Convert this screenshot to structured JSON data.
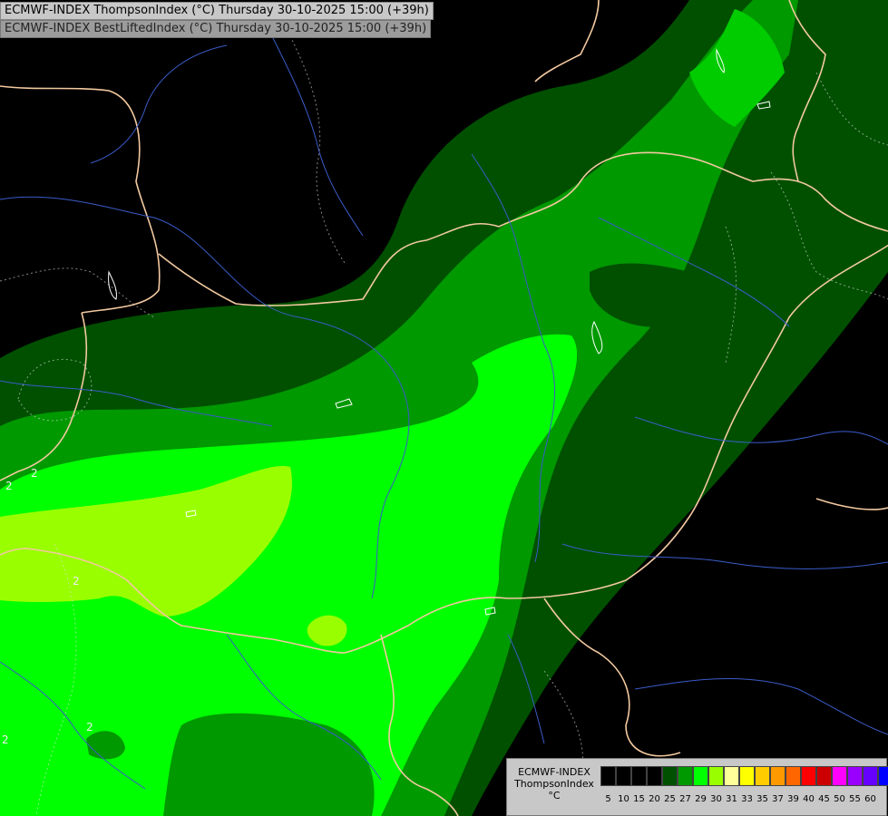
{
  "header": {
    "title_line1": "ECMWF-INDEX ThompsonIndex (°C) Thursday 30-10-2025 15:00 (+39h)",
    "title_line2": "ECMWF-INDEX BestLiftedIndex (°C) Thursday 30-10-2025 15:00 (+39h)"
  },
  "legend": {
    "line1": "ECMWF-INDEX",
    "line2": "ThompsonIndex",
    "line3": "°C",
    "items": [
      {
        "label": "5",
        "color": "#000000"
      },
      {
        "label": "10",
        "color": "#000000"
      },
      {
        "label": "15",
        "color": "#000000"
      },
      {
        "label": "20",
        "color": "#000000"
      },
      {
        "label": "25",
        "color": "#005000"
      },
      {
        "label": "27",
        "color": "#009900"
      },
      {
        "label": "29",
        "color": "#00ff00"
      },
      {
        "label": "30",
        "color": "#99ff00"
      },
      {
        "label": "31",
        "color": "#ffff99"
      },
      {
        "label": "33",
        "color": "#ffff00"
      },
      {
        "label": "35",
        "color": "#ffcc00"
      },
      {
        "label": "37",
        "color": "#ff9900"
      },
      {
        "label": "39",
        "color": "#ff6600"
      },
      {
        "label": "40",
        "color": "#ff0000"
      },
      {
        "label": "45",
        "color": "#cc0000"
      },
      {
        "label": "50",
        "color": "#ff00ff"
      },
      {
        "label": "55",
        "color": "#9900ff"
      },
      {
        "label": "60",
        "color": "#6600ff"
      },
      {
        "label": "",
        "color": "#0000ff"
      }
    ]
  },
  "contour_labels": [
    "2",
    "2",
    "2",
    "2",
    "2"
  ],
  "colors": {
    "background": "#000000",
    "dark_green": "#005000",
    "mid_green": "#009900",
    "bright_green": "#00ff00",
    "yellow_green": "#99ff00",
    "border": "#f2c9a0",
    "river": "#4060c0"
  }
}
